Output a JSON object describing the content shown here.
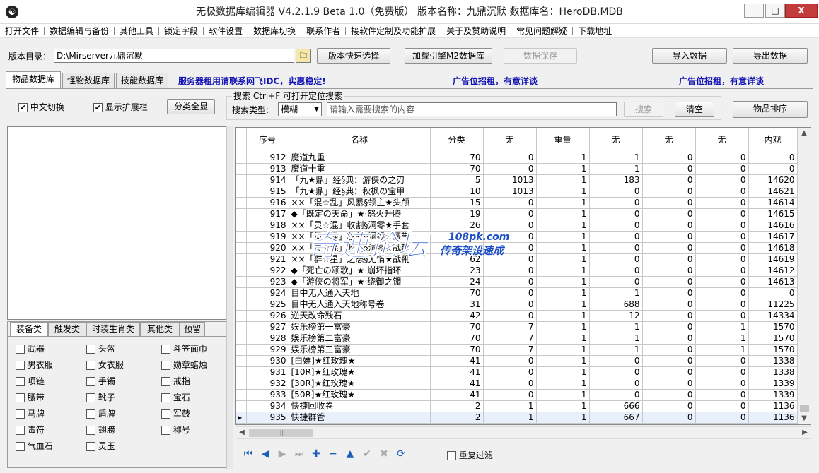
{
  "title": "无极数据库编辑器 V4.2.1.9   Beta 1.0（免费版）   版本名称：九鼎沉默     数据库名：HeroDB.MDB",
  "window_buttons": {
    "minimize": "—",
    "maximize": "□",
    "close": "X"
  },
  "menu": [
    "打开文件",
    "数据编辑与备份",
    "其他工具",
    "锁定字段",
    "软件设置",
    "数据库切换",
    "联系作者",
    "接软件定制及功能扩展",
    "关于及赞助说明",
    "常见问题解疑",
    "下载地址"
  ],
  "toolbar": {
    "dir_label": "版本目录：",
    "dir_value": "D:\\Mirserver九鼎沉默",
    "quick_select": "版本快速选择",
    "load_m2": "加载引擎M2数据库",
    "save": "数据保存",
    "import": "导入数据",
    "export": "导出数据"
  },
  "tabs": [
    "物品数据库",
    "怪物数据库",
    "技能数据库"
  ],
  "ads": [
    "服务器租用请联系网飞IDC，实惠稳定!",
    "广告位招租，有意详谈",
    "广告位招租，有意详谈"
  ],
  "options": {
    "chinese": "中文切换",
    "show_ext": "显示扩展栏",
    "show_all": "分类全显"
  },
  "search": {
    "hint": "搜索   Ctrl+F  可打开定位搜索",
    "type_label": "搜索类型:",
    "type_value": "模糊",
    "placeholder": "请输入需要搜索的内容",
    "search_btn": "搜索",
    "clear_btn": "清空",
    "sort_btn": "物品排序"
  },
  "grid": {
    "columns": [
      "序号",
      "名称",
      "分类",
      "无",
      "重量",
      "无",
      "无",
      "无",
      "内观"
    ],
    "rows": [
      [
        "912",
        "魔道九重",
        "70",
        "0",
        "1",
        "1",
        "0",
        "0",
        "0"
      ],
      [
        "913",
        "魔道十重",
        "70",
        "0",
        "1",
        "1",
        "0",
        "0",
        "0"
      ],
      [
        "914",
        "「九★鼎」经§典：游侠の之刃",
        "5",
        "1013",
        "1",
        "183",
        "0",
        "0",
        "14620"
      ],
      [
        "915",
        "「九★鼎」经§典：秋枫の宝甲",
        "10",
        "1013",
        "1",
        "0",
        "0",
        "0",
        "14621"
      ],
      [
        "916",
        "××「混☆乱」风暴§领主★头颅",
        "15",
        "0",
        "1",
        "0",
        "0",
        "0",
        "14614"
      ],
      [
        "917",
        "◆「既定の天命」★·怒火升腾",
        "19",
        "0",
        "1",
        "0",
        "0",
        "0",
        "14615"
      ],
      [
        "918",
        "××「灵☆混」收割§洞零★手套",
        "26",
        "0",
        "1",
        "0",
        "0",
        "0",
        "14616"
      ],
      [
        "919",
        "××「灵☆混」收割§洞零★腰带",
        "",
        "0",
        "1",
        "0",
        "0",
        "0",
        "14617"
      ],
      [
        "920",
        "××「灵☆混」收割§洞零★战靴",
        "",
        "0",
        "1",
        "0",
        "0",
        "0",
        "14618"
      ],
      [
        "921",
        "××「群☆星」之怒§无情★战靴",
        "62",
        "0",
        "1",
        "0",
        "0",
        "0",
        "14619"
      ],
      [
        "922",
        "◆「死亡の颂歌」★·崩坏指环",
        "23",
        "0",
        "1",
        "0",
        "0",
        "0",
        "14612"
      ],
      [
        "923",
        "◆「游侠の将军」★·绕御之镯",
        "24",
        "0",
        "1",
        "0",
        "0",
        "0",
        "14613"
      ],
      [
        "924",
        "目中无人通入天地",
        "70",
        "0",
        "1",
        "1",
        "0",
        "0",
        "0"
      ],
      [
        "925",
        "目中无人通入天地称号卷",
        "31",
        "0",
        "1",
        "688",
        "0",
        "0",
        "11225"
      ],
      [
        "926",
        "逆天改命残石",
        "42",
        "0",
        "1",
        "12",
        "0",
        "0",
        "14334"
      ],
      [
        "927",
        "娱乐榜第一富豪",
        "70",
        "7",
        "1",
        "1",
        "0",
        "1",
        "1570"
      ],
      [
        "928",
        "娱乐榜第二富豪",
        "70",
        "7",
        "1",
        "1",
        "0",
        "1",
        "1570"
      ],
      [
        "929",
        "娱乐榜第三富豪",
        "70",
        "7",
        "1",
        "1",
        "0",
        "1",
        "1570"
      ],
      [
        "930",
        "[白嫖]★红玫瑰★",
        "41",
        "0",
        "1",
        "0",
        "0",
        "0",
        "1338"
      ],
      [
        "931",
        "[10R]★红玫瑰★",
        "41",
        "0",
        "1",
        "0",
        "0",
        "0",
        "1338"
      ],
      [
        "932",
        "[30R]★红玫瑰★",
        "41",
        "0",
        "1",
        "0",
        "0",
        "0",
        "1339"
      ],
      [
        "933",
        "[50R]★红玫瑰★",
        "41",
        "0",
        "1",
        "0",
        "0",
        "0",
        "1339"
      ],
      [
        "934",
        "快捷回收卷",
        "2",
        "1",
        "1",
        "666",
        "0",
        "0",
        "1136"
      ],
      [
        "935",
        "快捷群管",
        "2",
        "1",
        "1",
        "667",
        "0",
        "0",
        "1136"
      ]
    ]
  },
  "category_tabs": [
    "装备类",
    "触发类",
    "时装生肖类",
    "其他类",
    "预留"
  ],
  "categories": [
    "武器",
    "头盔",
    "斗笠面巾",
    "男衣服",
    "女衣服",
    "勋章蜡烛",
    "项链",
    "手镯",
    "戒指",
    "腰带",
    "靴子",
    "宝石",
    "马牌",
    "盾牌",
    "军鼓",
    "毒符",
    "翅膀",
    "称号",
    "气血石",
    "灵玉"
  ],
  "nav_icons": [
    "first-icon",
    "prev-icon",
    "next-icon",
    "last-icon",
    "add-icon",
    "delete-icon",
    "up-icon",
    "confirm-icon",
    "cancel-icon",
    "refresh-icon"
  ],
  "nav_glyphs": [
    "⏮",
    "◀",
    "▶",
    "⏭",
    "✚",
    "━",
    "▲",
    "✔",
    "✖",
    "⟳"
  ],
  "dedupe_label": "重复过滤",
  "watermark": {
    "main": "奇速论坛",
    "site": "108pk.com",
    "slogan": "传奇架设速成"
  }
}
